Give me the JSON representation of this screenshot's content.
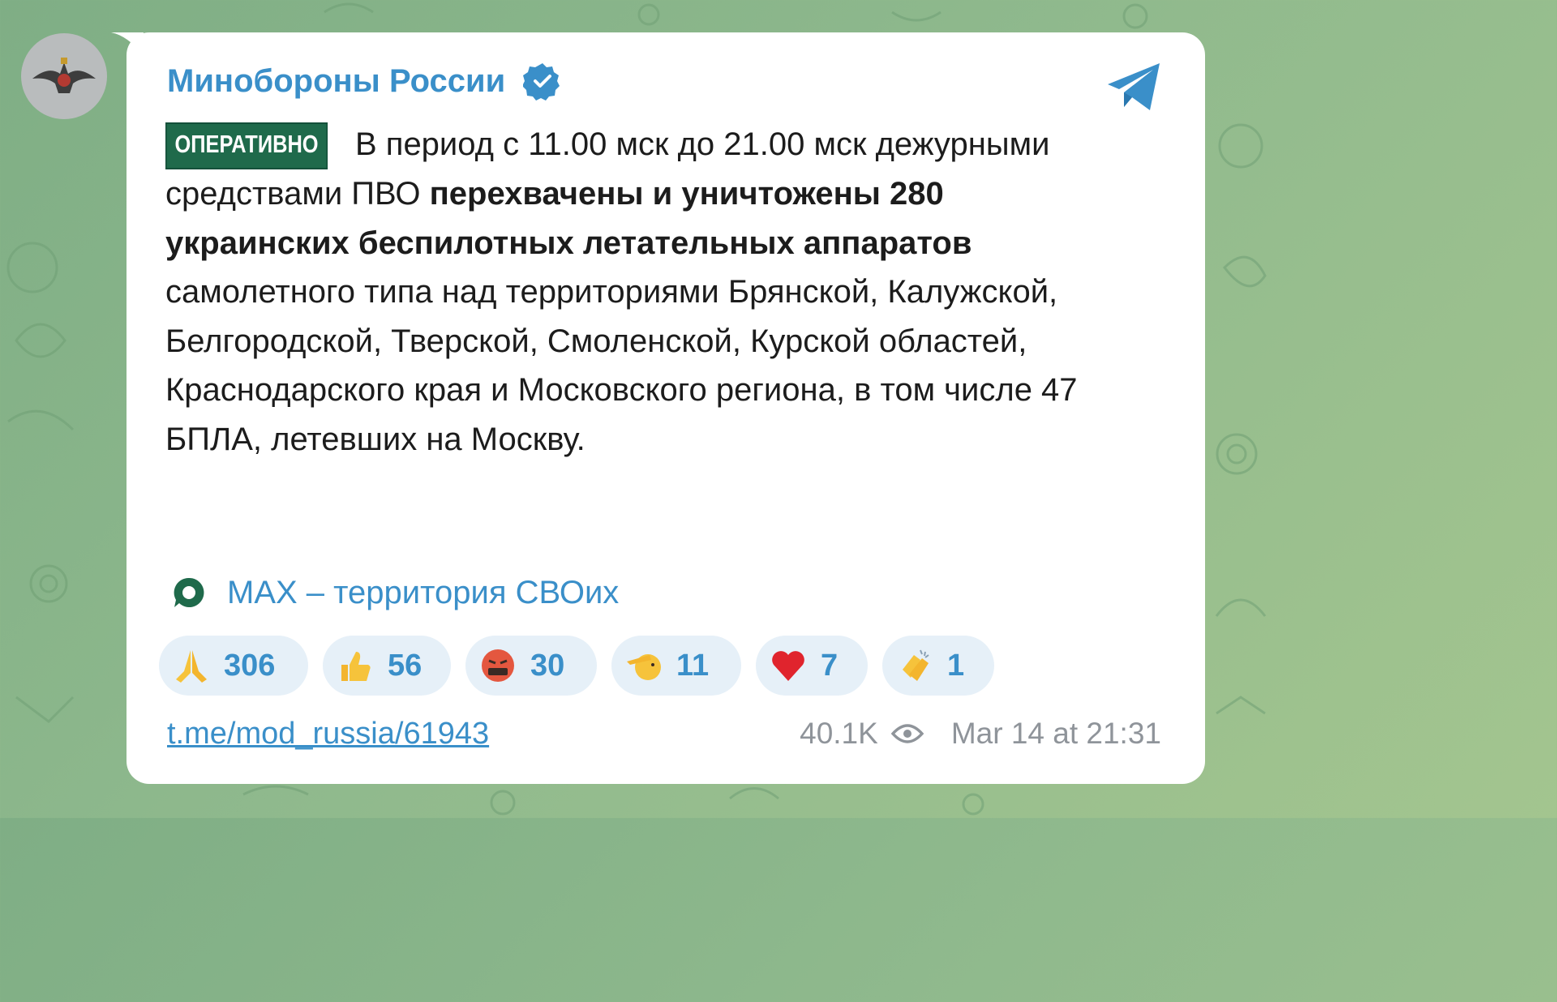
{
  "channel": {
    "name": "Минобороны России",
    "verified_icon": "verified-badge-icon"
  },
  "post": {
    "tag": "ОПЕРАТИВНО",
    "segments": [
      {
        "text": "В период с 11.00 мск до 21.00 мск дежурными средствами ПВО ",
        "bold": false
      },
      {
        "text": "перехвачены и уничтожены 280 украинских беспилотных летательных аппаратов",
        "bold": true
      },
      {
        "text": " самолетного типа над территориями Брянской, Калужской, Белгородской, Тверской, Смоленской, Курской областей, Краснодарского края и Московского региона, в том числе 47 БПЛА, летевших на Москву.",
        "bold": false
      }
    ],
    "promo_link": "MAX – территория СВОих"
  },
  "reactions": [
    {
      "emoji": "praying-hands",
      "count": "306"
    },
    {
      "emoji": "thumbs-up",
      "count": "56"
    },
    {
      "emoji": "swearing-face",
      "count": "30"
    },
    {
      "emoji": "saluting-face",
      "count": "11"
    },
    {
      "emoji": "red-heart",
      "count": "7"
    },
    {
      "emoji": "clapping-hands",
      "count": "1"
    }
  ],
  "footer": {
    "link": "t.me/mod_russia/61943",
    "views": "40.1K",
    "timestamp": "Mar 14 at 21:31"
  },
  "colors": {
    "accent": "#3a8fc9",
    "tag_bg": "#1f6a4b",
    "reaction_bg": "#e6f0f8",
    "meta": "#8f949a"
  }
}
